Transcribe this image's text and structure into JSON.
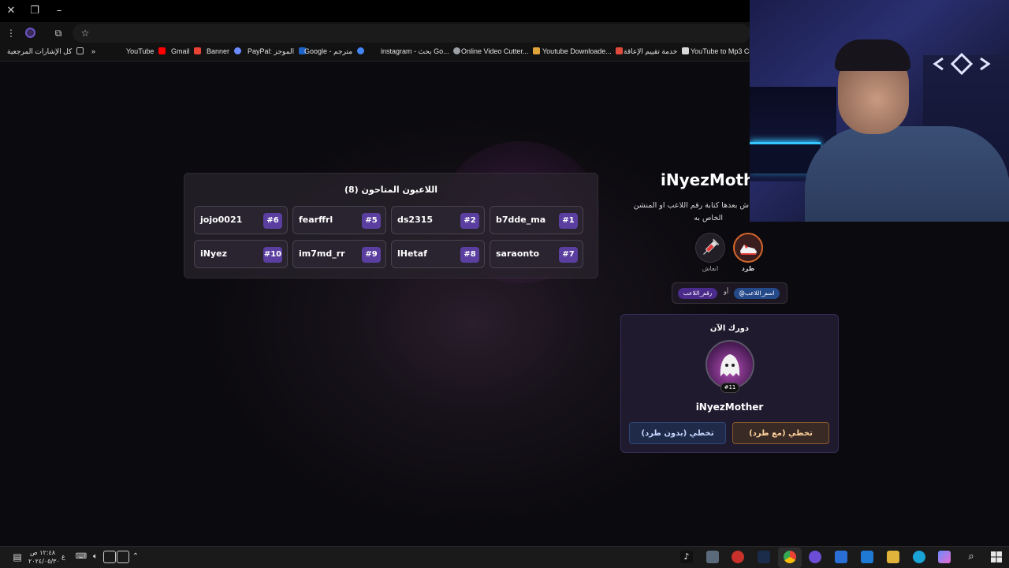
{
  "browser": {
    "bookmarks": [
      {
        "label": "كل الإشارات المرجعية",
        "color": "#bbbbbb"
      },
      {
        "label": "YouTube",
        "color": "#ff0000"
      },
      {
        "label": "Gmail",
        "color": "#ea4335"
      },
      {
        "label": "Banner",
        "color": "#6b8cff"
      },
      {
        "label": "PayPal: الموجز",
        "color": "#1d63c8"
      },
      {
        "label": "Google - مترجم",
        "color": "#4285f4"
      },
      {
        "label": "instagram - بحث Go...",
        "color": "#9aa0a6"
      },
      {
        "label": "Online Video Cutter...",
        "color": "#e0a43a"
      },
      {
        "label": "Youtube Downloade...",
        "color": "#e04a3a"
      },
      {
        "label": "خدمة تقييم الإعاقة",
        "color": "#d8d8d8"
      },
      {
        "label": "YouTube to Mp3 Co...",
        "color": "#d8d8d8"
      }
    ],
    "more_bookmarks": "»"
  },
  "eliminated_panel": {
    "title": "اللاعبون المتاحون (8)",
    "players": [
      {
        "name": "jojo0021",
        "num": "#6"
      },
      {
        "name": "fearffrl",
        "num": "#5"
      },
      {
        "name": "ds2315",
        "num": "#2"
      },
      {
        "name": "b7dde_ma",
        "num": "#1"
      },
      {
        "name": "iNyez",
        "num": "#10"
      },
      {
        "name": "im7md_rr",
        "num": "#9"
      },
      {
        "name": "lHetaf",
        "num": "#8"
      },
      {
        "name": "saraonto",
        "num": "#7"
      }
    ]
  },
  "current": {
    "player_title": "iNyezMoth",
    "instruction_line1": "ش بعدها كتابة رقم اللاعب او المنشن",
    "instruction_line2": "الخاص به",
    "actions": [
      {
        "label": "طرد",
        "icon": "sneaker-icon"
      },
      {
        "label": "انعاش",
        "icon": "syringe-icon"
      }
    ],
    "tag_name": "@اسم_اللاعب",
    "tag_or": "أو",
    "tag_number": "رقم_اللاعب"
  },
  "turn": {
    "title": "دورك الآن",
    "avatar_num": "#11",
    "name": "iNyezMother",
    "btn_skip_kick": "تخطي (مع طرد)",
    "btn_skip_nokick": "تخطي (بدون طرد)"
  },
  "taskbar": {
    "time": "١٢:٤٨ ص",
    "date": "٢٠٢٤/٠٥/٣٠",
    "lang": "ع"
  },
  "colors": {
    "accent_purple": "#5b3fa0",
    "kick_orange": "#8a5a2a",
    "nokick_blue": "#2f4678",
    "cam_blue": "#2a2f70"
  }
}
